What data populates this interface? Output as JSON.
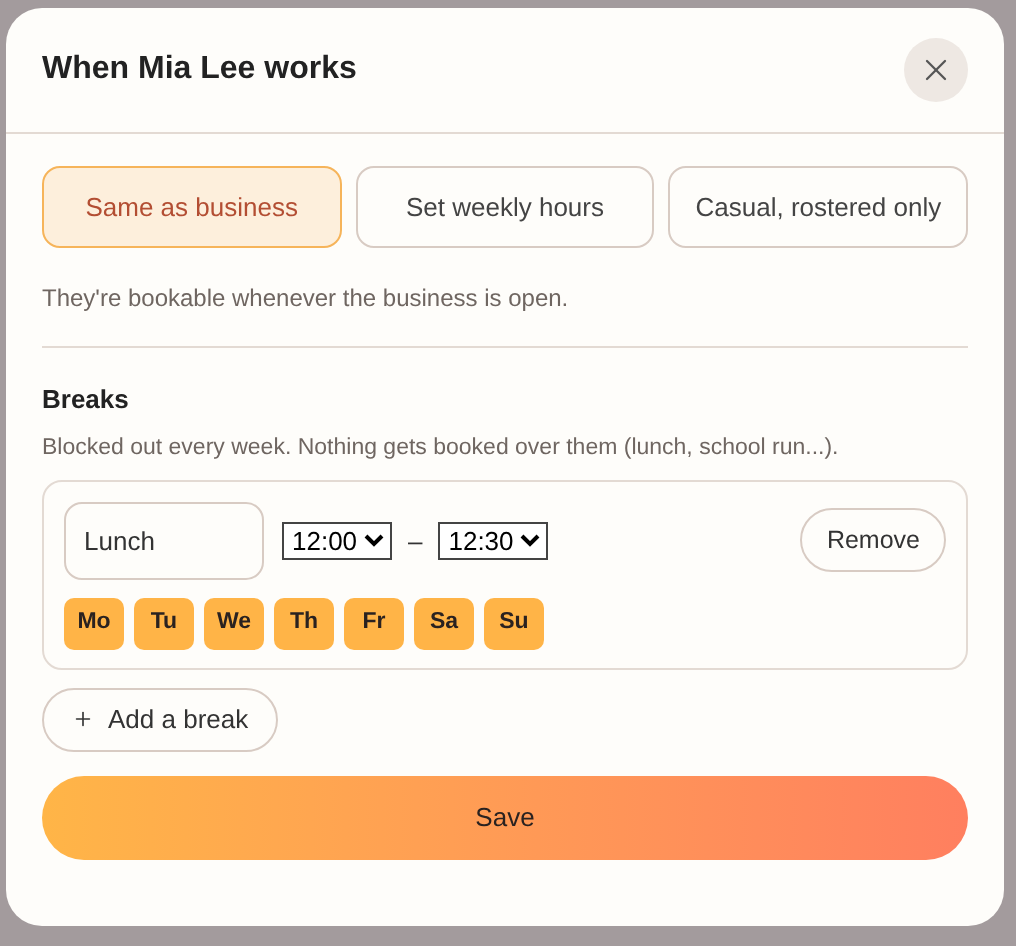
{
  "dialog": {
    "title": "When Mia Lee works"
  },
  "modes": [
    {
      "label": "Same as business",
      "selected": true
    },
    {
      "label": "Set weekly hours",
      "selected": false
    },
    {
      "label": "Casual, rostered only",
      "selected": false
    }
  ],
  "mode_description": "They're bookable whenever the business is open.",
  "breaks": {
    "heading": "Breaks",
    "description": "Blocked out every week. Nothing gets booked over them (lunch, school run...).",
    "items": [
      {
        "name": "Lunch",
        "start": "12:00",
        "dash": "–",
        "end": "12:30",
        "remove": "Remove",
        "days": [
          {
            "label": "Mo",
            "selected": true
          },
          {
            "label": "Tu",
            "selected": true
          },
          {
            "label": "We",
            "selected": true
          },
          {
            "label": "Th",
            "selected": true
          },
          {
            "label": "Fr",
            "selected": true
          },
          {
            "label": "Sa",
            "selected": true
          },
          {
            "label": "Su",
            "selected": true
          }
        ]
      }
    ],
    "add": "Add a break"
  },
  "save": "Save"
}
